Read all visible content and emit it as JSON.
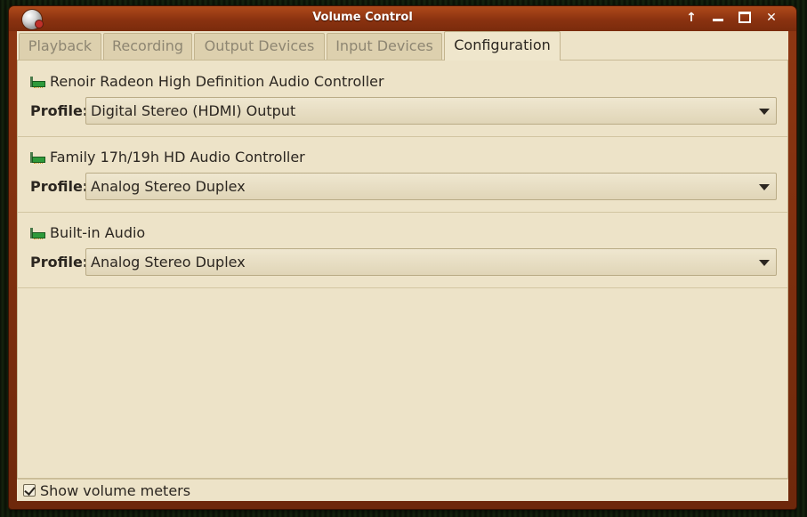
{
  "window": {
    "title": "Volume Control",
    "controls": {
      "up_icon": "↑",
      "minimize_icon": "minimize",
      "maximize_icon": "maximize",
      "close_icon": "✕"
    }
  },
  "tabs": [
    {
      "label": "Playback",
      "active": false
    },
    {
      "label": "Recording",
      "active": false
    },
    {
      "label": "Output Devices",
      "active": false
    },
    {
      "label": "Input Devices",
      "active": false
    },
    {
      "label": "Configuration",
      "active": true
    }
  ],
  "profile_label": "Profile:",
  "devices": [
    {
      "name": "Renoir Radeon High Definition Audio Controller",
      "profile": "Digital Stereo (HDMI) Output"
    },
    {
      "name": "Family 17h/19h HD Audio Controller",
      "profile": "Analog Stereo Duplex"
    },
    {
      "name": "Built-in Audio",
      "profile": "Analog Stereo Duplex"
    }
  ],
  "footer": {
    "show_meters_label": "Show volume meters",
    "show_meters_checked": true
  },
  "colors": {
    "titlebar": "#8a3210",
    "panel": "#ede3c8",
    "device_icon": "#2e9a3a"
  }
}
